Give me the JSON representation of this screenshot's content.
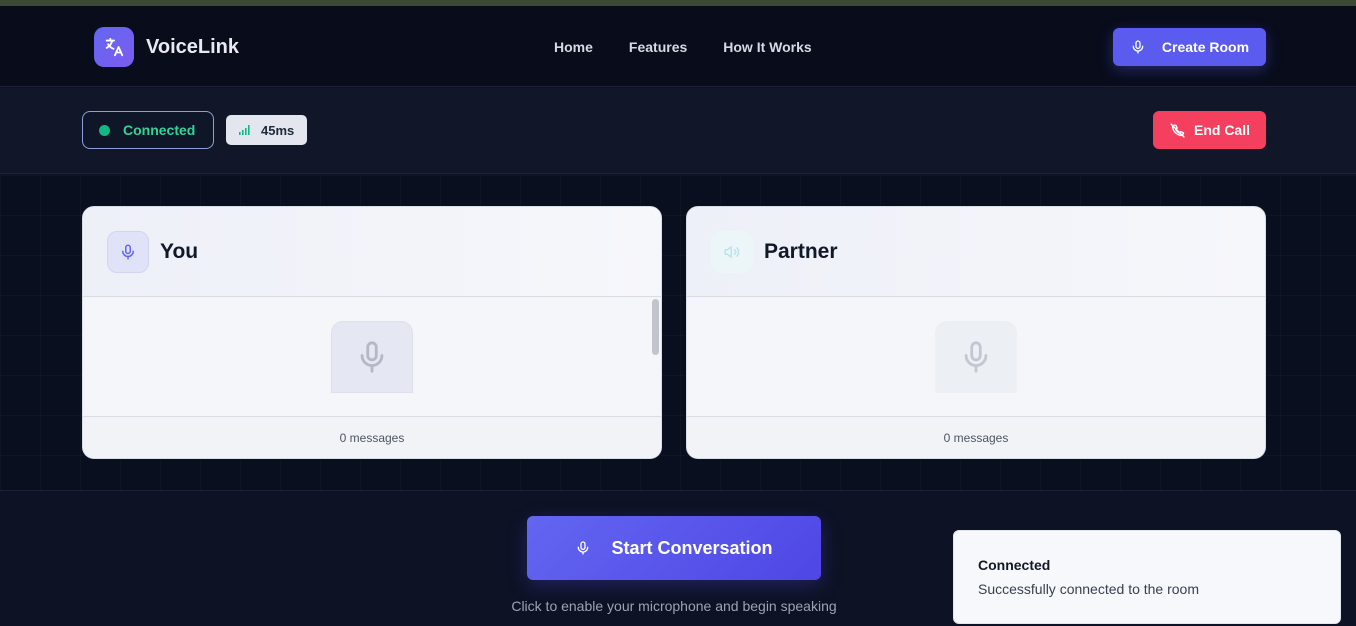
{
  "brand": {
    "name": "VoiceLink",
    "logo_icon": "translate-icon"
  },
  "nav": {
    "links": [
      "Home",
      "Features",
      "How It Works"
    ],
    "create_room_label": "Create Room"
  },
  "status": {
    "connection_label": "Connected",
    "latency": "45ms",
    "end_call_label": "End Call",
    "colors": {
      "connected": "#10b981",
      "end_call": "#f43f5e",
      "accent": "#5b5bf0"
    }
  },
  "panels": [
    {
      "title": "You",
      "icon": "mic-icon",
      "footer": "0 messages"
    },
    {
      "title": "Partner",
      "icon": "speaker-icon",
      "footer": "0 messages"
    }
  ],
  "cta": {
    "label": "Start Conversation",
    "hint": "Click to enable your microphone and begin speaking"
  },
  "toast": {
    "title": "Connected",
    "message": "Successfully connected to the room"
  }
}
